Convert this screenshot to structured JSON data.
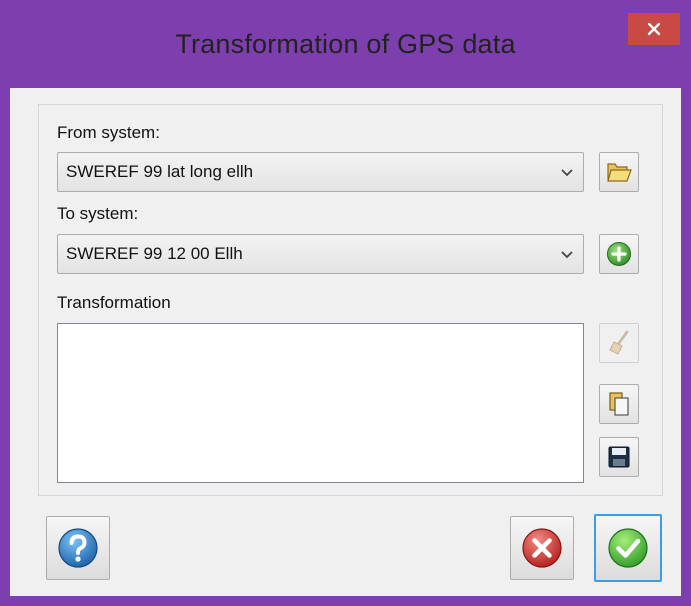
{
  "window": {
    "title": "Transformation of GPS data",
    "close_icon": "close-icon",
    "accent_color": "#7e3fae"
  },
  "form": {
    "from_label": "From system:",
    "from_value": "SWEREF 99 lat long ellh",
    "to_label": "To system:",
    "to_value": "SWEREF 99 12 00 Ellh",
    "transformation_label": "Transformation",
    "transformation_text": ""
  },
  "icons": {
    "open": "folder-open-icon",
    "add": "add-icon",
    "clear": "broom-icon",
    "copy": "copy-icon",
    "save": "floppy-disk-icon",
    "help": "help-icon",
    "cancel": "cancel-icon",
    "ok": "check-icon"
  }
}
